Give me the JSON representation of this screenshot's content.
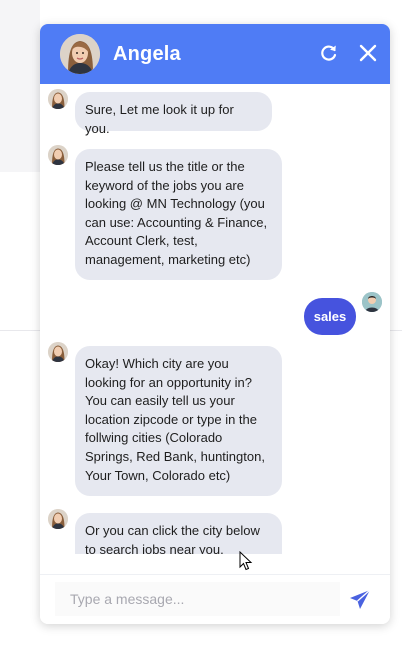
{
  "header": {
    "agent_name": "Angela",
    "refresh_icon": "refresh-icon",
    "close_icon": "close-icon"
  },
  "messages": [
    {
      "sender": "bot",
      "text": "Sure, Let me look it up for you."
    },
    {
      "sender": "bot",
      "text": "Please tell us the title or the keyword of the jobs you are looking @ MN Technology (you can use: Accounting & Finance, Account Clerk, test, management, marketing etc)"
    },
    {
      "sender": "user",
      "text": "sales"
    },
    {
      "sender": "bot",
      "text": "Okay! Which city are you looking for an opportunity in? You can easily tell us your location zipcode or type in the follwing cities (Colorado Springs, Red Bank, huntington, Your Town, Colorado etc)"
    },
    {
      "sender": "bot",
      "text": "Or you can click the city below to search jobs near you."
    }
  ],
  "composer": {
    "placeholder": "Type a message...",
    "value": "",
    "send_icon": "send-icon"
  },
  "colors": {
    "header_bg": "#4f7cf5",
    "bot_bubble": "#e6e8f0",
    "user_bubble": "#4653de",
    "send_icon": "#4a62e0"
  }
}
